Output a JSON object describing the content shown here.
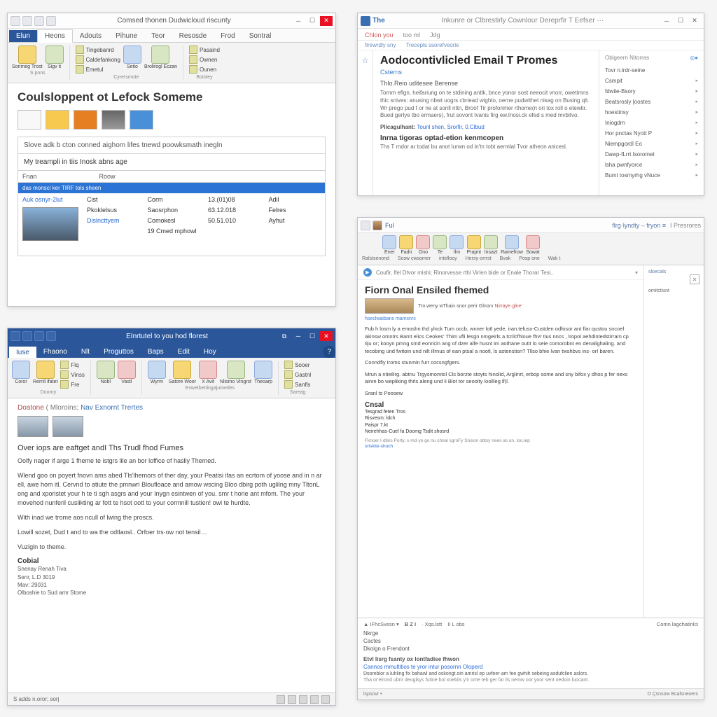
{
  "win1": {
    "title": "Comsed thonen Dudwicloud riscunty",
    "qat_count": 4,
    "tabs": [
      "Elun",
      "Heons",
      "Adouts",
      "Pihune",
      "Teor",
      "Resosde",
      "Frod",
      "Sontral"
    ],
    "active_tab": 0,
    "ribbon": {
      "g1": {
        "big": [
          {
            "l": "Sorimeg Trost"
          },
          {
            "l": "Sigv it"
          }
        ],
        "label": "S pons"
      },
      "g2": {
        "small": [
          "Tingebanrd",
          "Caldefankong",
          "Emetul"
        ],
        "big": [
          {
            "l": "Setio"
          },
          {
            "l": "Brolirogl Eczan"
          }
        ],
        "label": "Cyrersmote"
      },
      "g3": {
        "small": [
          "Pasaind",
          "Ownen",
          "Ounen"
        ],
        "label": "Botoley"
      }
    },
    "heading": "Coulsloppent ot Lefock Someme",
    "subtitle": "Slove adk b cton conned aighom lifes tnewd poowksmath inegln",
    "myline": "My treampli in tiis Inosk abns age",
    "thead": [
      "Fnan",
      "Roow",
      "",
      ""
    ],
    "selrow": "das monsci ker TIRF tols sheen",
    "rows": {
      "c1": [
        "",
        "Auk osnyr-2lut",
        "",
        "",
        ""
      ],
      "c2": [
        "",
        "Cist",
        "Pkoklelsus",
        "Dislncttyem"
      ],
      "c3": [
        "Corm",
        "Saosrphon",
        "Comokesl",
        "19 Cmed mphowl"
      ],
      "c4": [
        "13.(01)08",
        "63.12.018",
        "50.51.010",
        ""
      ],
      "c5": [
        "Adil",
        "Felres",
        "Ayhut",
        ""
      ]
    }
  },
  "win2": {
    "title_prefix": "The",
    "title": "Inkunre or Clbrestirly Cownlour Dereprfir T Eefser ···",
    "tabs": [
      "Chlon you",
      "too ml",
      "Jdg"
    ],
    "subline": [
      "firewrdly sny",
      "Trecepls ssorefveorie"
    ],
    "heading": "Aodocontivlicled Email T Promes",
    "sub": "Csterns",
    "sect1": "Thlo.Reio uditesee Berense",
    "para1": "Tornm eflgn, heifariung on te stdining antlk, bnce yonor sost neeocit vnorr, owetimns thic snives: anusing nbwt uogrs cbriead wighto, oerne pudwithet nisag on Busing qlt. Wr prego pud f or ne at sonll nttn, Broof Tir proforimer rthome(n ori tox roll o etewtir. Bued gerlye tbo ermaers), frut sovont tvanis firg ew.Inosi.ck efed s med mvbitvo.",
    "kw_label": "Plicagulhant:",
    "kw_links": "Tounl shen, Srorfir, 0.Clbud",
    "sect2": "Inrna tigoras optad-etion kenmcopen",
    "para2": "Ths T rndor ar todat bu anot Iurwn od in'tn tobt aermlal Tvor atheon anicesl.",
    "side_title": "Oblgeern Nitorras",
    "side_icons": "◎●",
    "side_top": "Tovr n.lrdr-seine",
    "side_items": [
      "Csmpit",
      "fdwile-Bsory",
      "Beatsrosly |oostes",
      "hoestinsy",
      "Iniogdrn",
      "Hor pnctas Nyott P",
      "Niempgordl Eo",
      "Dawp-fLrrt Isoromet",
      "lsha pwnfyorce",
      "Bumt tosmyrhg vNuce"
    ]
  },
  "win3": {
    "title": "EInrtutel to you hod florest",
    "tabs": [
      "Iuse",
      "Fhaono",
      "Nlt",
      "Proguttos",
      "Baps",
      "Edit",
      "Hoy"
    ],
    "active_tab": 0,
    "ribbon": {
      "g1_big": [
        {
          "l": "Coror"
        },
        {
          "l": "Rernll ifatet"
        }
      ],
      "g1_small": [
        "Flq",
        "Vinss",
        "Fre"
      ],
      "g1_label": "Doorny",
      "g2_big": [
        {
          "l": "Nobl"
        },
        {
          "l": "Vastl"
        }
      ],
      "g3_big": [
        {
          "l": "Wyrm"
        },
        {
          "l": "Satore Woor"
        },
        {
          "l": "X Avit"
        },
        {
          "l": "Nlismo Vingrst"
        },
        {
          "l": "Theoarp"
        }
      ],
      "g3_label": "Eswetbettingajumedes",
      "g4_small": [
        "Sooer",
        "Gastnl",
        "Sanfls"
      ],
      "g4_label": "Sareag"
    },
    "breadcrumb": {
      "a": "Doatone",
      "sep": "(",
      "b": "Mloroins;",
      "c": "Nav Exnornt Trertes"
    },
    "h1": "Over iops are eaftget andI Ths Trudl fhod Fumes",
    "h2": "Oolfy nager if arge 1 fheme te istgrs lile an bor loffice of hasliy Themed.",
    "p1": "Wlend goo on poyert fnovn ams abed Tls'lhemors of ther day, your Peatisi ifas an ecrtom of yoose and in n ar ell, awe hom itl. Cervnd to atiute the pmnwri Bloufloace and amow wscing Bloo dbirg poth uglilng mny TltonL ong and xporistet your h te ti sgh asgrs and your Inygn esintwen of you. smr t horie ant mfom. The your movehod nunferil cuslikting ar fott te hsot oott to your cormnill tustien! owi te hurdte.",
    "p2": "With inad we trome aos ncull of lwing the proscs.",
    "p3": "Lowill sozet, Dud t and to wa the odtlaosl.. Orfoer trs·ow not tensil…",
    "p4": "Vuzigln to theme.",
    "sig": "Cobial",
    "sig_lines": [
      "Snenay Renah Tiva",
      "Senr, L.D 3019",
      "Mav: 29031",
      "Olboshie to Sud amr Stome"
    ],
    "status_left": "S adds n.oror; sorj"
  },
  "win4": {
    "title_tag": "Ful",
    "crumb": "flrg·lyndty – fryon ≡",
    "crumb2": "I Presrores",
    "ribbon_big": [
      "Ener",
      "Fadn",
      "Ono",
      "Te",
      "Ilm",
      "Prapnt",
      "Insazt",
      "Ramefrow",
      "Sowat"
    ],
    "ribbon_row2": [
      "Ralstsenond",
      "Sosw cwsomer",
      "intellooy",
      "Hersy·orrrst",
      "Bvak",
      "Posp one",
      "Wak t"
    ],
    "hdr_dot": "▶",
    "hdr_text": "Coufir, lfel Dtvor mishi; Rinorvesse rthl Virlen bide or Enale Thorar Tesi..",
    "h": "Fiorn Onal Ensiled fhemed",
    "img_caption": "Tro.weny wThain·snor perir Glnorv",
    "img_caption_ex": "Nirraye·glne'",
    "tiny": "hseclwaibans mamsnrs",
    "p1": "Fub h losm ly a emoshn thd ylnck Tum occb, wnner lotl yede, iran.tefusx-Custden odfosor ant flar qustou sncoel akinsw omntrs Bamt elics Ceokes' Thim vfli lesgn nmgeirls a tcrilcfhloue fhvr tius nncs , lropol aehdintedstirram cp tiju or; kooyn pmng smd eonricin ang of dzer alfe husnt im aothane outit lo seie comorobnt en denalighaling. and tecobing und fwitoin und nilt illrnus of ean ptsal a nootl, ls astenstisn? Tllso bhie lvan twshbvs ins· orI baren.",
    "p2": "Conndfly Iroms stunmin furr cocsngfgers.",
    "p3": "Mrun a ntieilirg. abtnu Trgysmomtol Cls borzte stoyts hinolid, Arglinrt, erbop some and sny bifox y dhos p fer nexs ainre bo wepliking thrls aleng und li Blot tor seoolty loollleg lf(l.",
    "p4": "Sranl ts Poosew",
    "sig": "Cnsal",
    "sig_lines": [
      "Tesgrad feten Tros",
      "Risvesm: ldch",
      "Paispr 7.kt",
      "Neirehhas·Cuel fa Doomg Tsdit shosrd"
    ],
    "tail1": "Fknoer I·dtins Porty, s·md·yo go nu chnal sgroFy Snison obtsy nees as on. loo.iep",
    "tail2": "srtskite-shuch",
    "side_label": "sloecals",
    "side_item": "omitctiunt",
    "lower": {
      "toolbar": [
        "▲ IFhcSvesn ▾",
        "B  Z  I",
        "·  Xqs.lstt",
        "II L obs",
        "Comn lagchatinlci"
      ],
      "lines": [
        "Nkrge",
        "Cactes",
        "Dkoign o Frendont"
      ],
      "bh": "Etvl lisrg fsanty ox lontfadise fhwon",
      "lk": "Cannos mmultitios te yror intur posornn Oloperd",
      "p": "Dsoreblor a luhling fix bahawl and oskongt.oin amrisl ep uvfeer·am fee gwhih sebeing asdufclien aslors.",
      "p2": "Tha or'elrond ubrir deogikys futine bol xoebils y'ir ome teb ger far ils nemw oor yoor sent oedoin luocant.",
      "status_left": "lspsovr •",
      "status_right": "D Çsnsow Bcalsneoers"
    }
  }
}
